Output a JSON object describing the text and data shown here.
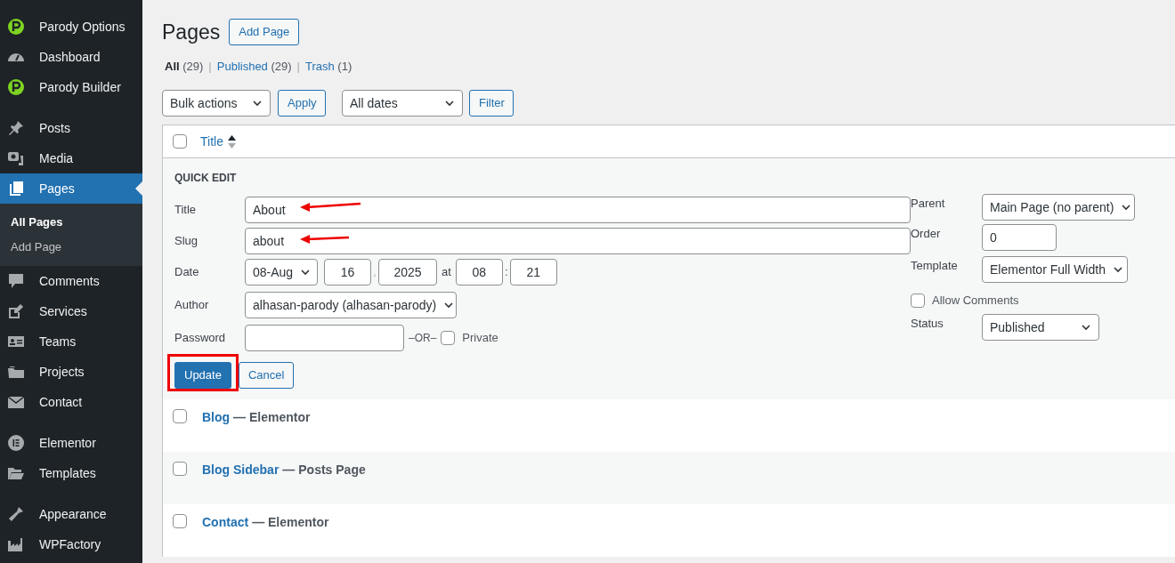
{
  "sidebar": {
    "groups": [
      {
        "items": [
          {
            "label": "Parody Options",
            "kind": "parody",
            "selected": false
          },
          {
            "label": "Dashboard",
            "kind": "dashboard",
            "selected": false
          },
          {
            "label": "Parody Builder",
            "kind": "parody",
            "selected": false
          }
        ]
      },
      {
        "items": [
          {
            "label": "Posts",
            "kind": "pin",
            "selected": false
          },
          {
            "label": "Media",
            "kind": "media",
            "selected": false
          },
          {
            "label": "Pages",
            "kind": "pages",
            "selected": true,
            "children": [
              {
                "label": "All Pages",
                "selected": true
              },
              {
                "label": "Add Page",
                "selected": false
              }
            ]
          },
          {
            "label": "Comments",
            "kind": "comment",
            "selected": false
          },
          {
            "label": "Services",
            "kind": "services",
            "selected": false
          },
          {
            "label": "Teams",
            "kind": "teams",
            "selected": false
          },
          {
            "label": "Projects",
            "kind": "projects",
            "selected": false
          },
          {
            "label": "Contact",
            "kind": "mail",
            "selected": false
          }
        ]
      },
      {
        "items": [
          {
            "label": "Elementor",
            "kind": "elementor",
            "selected": false
          },
          {
            "label": "Templates",
            "kind": "templates",
            "selected": false
          }
        ]
      },
      {
        "items": [
          {
            "label": "Appearance",
            "kind": "brush",
            "selected": false
          },
          {
            "label": "WPFactory",
            "kind": "factory",
            "selected": false
          }
        ]
      }
    ]
  },
  "page": {
    "title": "Pages",
    "add_button": "Add Page"
  },
  "filters": [
    {
      "label": "All",
      "count": "(29)",
      "selected": true
    },
    {
      "separator": "|",
      "label": "Published",
      "count": "(29)",
      "selected": false
    },
    {
      "separator": "|",
      "label": "Trash",
      "count": "(1)",
      "selected": false
    }
  ],
  "toolbar": {
    "bulk": "Bulk actions",
    "apply": "Apply",
    "dates": "All dates",
    "filter": "Filter"
  },
  "table": {
    "header": {
      "title": "Title",
      "checked": false
    },
    "quick_edit": {
      "heading": "QUICK EDIT",
      "title": {
        "label": "Title",
        "value": "About"
      },
      "slug": {
        "label": "Slug",
        "value": "about"
      },
      "date": {
        "label": "Date",
        "month": "08-Aug",
        "day": "16",
        "sep1": ",",
        "year": "2025",
        "at": "at",
        "hour": "08",
        "sep2": ":",
        "minute": "21"
      },
      "author": {
        "label": "Author",
        "value": "alhasan-parody (alhasan-parody)"
      },
      "password": {
        "label": "Password",
        "or": "–OR–",
        "private_label": "Private",
        "private_checked": false
      },
      "parent": {
        "label": "Parent",
        "value": "Main Page (no parent)"
      },
      "order": {
        "label": "Order",
        "value": "0"
      },
      "template": {
        "label": "Template",
        "value": "Elementor Full Width"
      },
      "allow_comments": {
        "label": "Allow Comments",
        "checked": false
      },
      "status": {
        "label": "Status",
        "value": "Published"
      },
      "update": "Update",
      "cancel": "Cancel"
    },
    "rows": [
      {
        "title": "Blog",
        "state": "— Elementor",
        "checked": false
      },
      {
        "title": "Blog Sidebar",
        "state": "— Posts Page",
        "checked": false
      },
      {
        "title": "Contact",
        "state": "— Elementor",
        "checked": false
      }
    ]
  }
}
